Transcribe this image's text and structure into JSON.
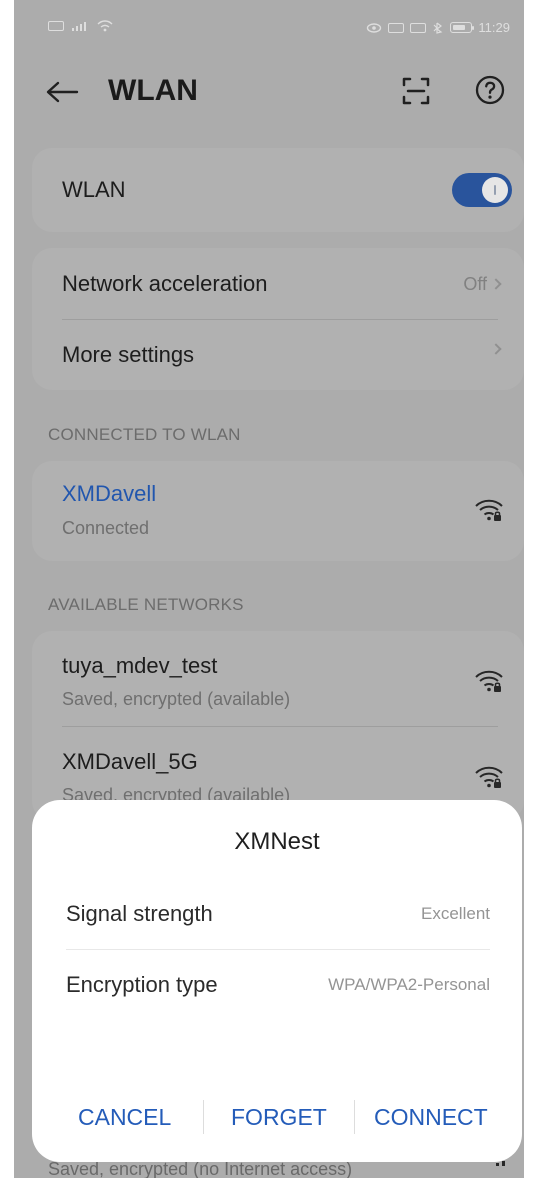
{
  "status": {
    "time": "11:29"
  },
  "header": {
    "title": "WLAN"
  },
  "wlan": {
    "label": "WLAN",
    "enabled": true
  },
  "settings": {
    "network_acceleration_label": "Network acceleration",
    "network_acceleration_value": "Off",
    "more_settings_label": "More settings"
  },
  "sections": {
    "connected_label": "CONNECTED TO WLAN",
    "available_label": "AVAILABLE NETWORKS"
  },
  "connected_network": {
    "name": "XMDavell",
    "status": "Connected"
  },
  "available_networks": [
    {
      "name": "tuya_mdev_test",
      "status": "Saved, encrypted (available)"
    },
    {
      "name": "XMDavell_5G",
      "status": "Saved, encrypted (available)"
    }
  ],
  "bottom_network": {
    "status": "Saved, encrypted (no Internet access)"
  },
  "dialog": {
    "title": "XMNest",
    "signal_strength_label": "Signal strength",
    "signal_strength_value": "Excellent",
    "encryption_type_label": "Encryption type",
    "encryption_type_value": "WPA/WPA2-Personal",
    "cancel_label": "CANCEL",
    "forget_label": "FORGET",
    "connect_label": "CONNECT"
  },
  "colors": {
    "accent": "#245cb9",
    "switch": "#2c5aa6"
  }
}
